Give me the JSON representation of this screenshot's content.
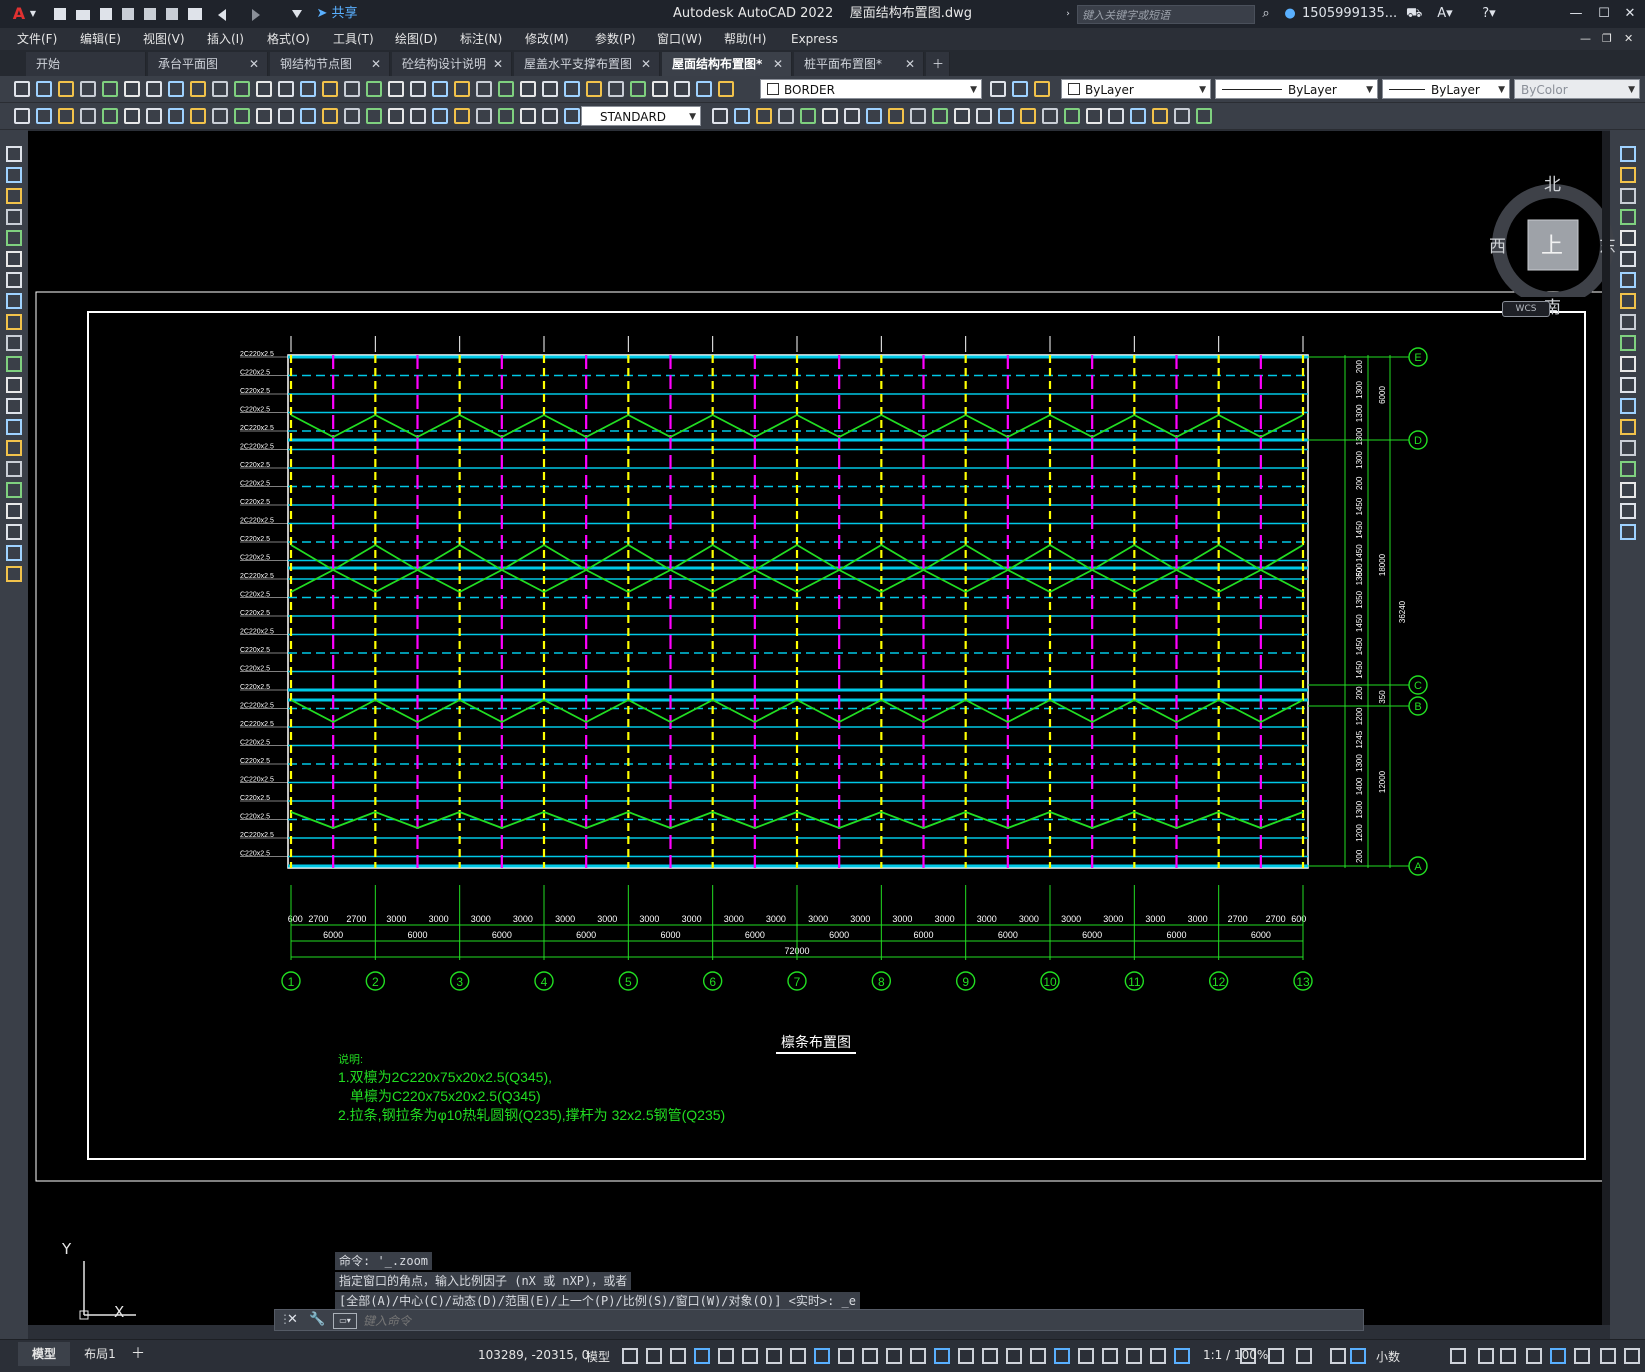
{
  "app": {
    "title": "Autodesk AutoCAD 2022",
    "filename": "屋面结构布置图.dwg",
    "share_label": "共享",
    "search_placeholder": "键入关键字或短语",
    "user": "1505999135...",
    "window_controls": [
      "minimize-icon",
      "maximize-icon",
      "close-icon"
    ]
  },
  "menu": [
    "文件(F)",
    "编辑(E)",
    "视图(V)",
    "插入(I)",
    "格式(O)",
    "工具(T)",
    "绘图(D)",
    "标注(N)",
    "修改(M)",
    "参数(P)",
    "窗口(W)",
    "帮助(H)",
    "Express"
  ],
  "tabs": [
    {
      "label": "开始",
      "active": false
    },
    {
      "label": "承台平面图",
      "active": false
    },
    {
      "label": "钢结构节点图",
      "active": false
    },
    {
      "label": "砼结构设计说明",
      "active": false
    },
    {
      "label": "屋盖水平支撑布置图",
      "active": false
    },
    {
      "label": "屋面结构布置图*",
      "active": true
    },
    {
      "label": "桩平面布置图*",
      "active": false
    }
  ],
  "toolbar": {
    "layer": "BORDER",
    "color": "ByLayer",
    "linetype": "ByLayer",
    "lineweight": "ByLayer",
    "plotstyle": "ByColor",
    "textstyle": "STANDARD"
  },
  "viewcube": {
    "north": "北",
    "south": "南",
    "east": "东",
    "west": "西",
    "face": "上",
    "wcs": "WCS"
  },
  "drawing": {
    "title": "檩条布置图",
    "notes": [
      "说明:",
      "1.双檩为2C220x75x20x2.5(Q345),",
      "单檩为C220x75x20x2.5(Q345)",
      "2.拉条,钢拉条为φ10热轧圆钢(Q235),撑杆为 32x2.5钢管(Q235)"
    ],
    "bottom_dims_top": [
      "600",
      "2700",
      "2700",
      "3000",
      "3000",
      "3000",
      "3000",
      "3000",
      "3000",
      "3000",
      "3000",
      "3000",
      "3000",
      "3000",
      "3000",
      "3000",
      "3000",
      "3000",
      "3000",
      "3000",
      "3000",
      "3000",
      "3000",
      "2700",
      "2700",
      "600"
    ],
    "bottom_dims_mid": [
      "6000",
      "6000",
      "6000",
      "6000",
      "6000",
      "6000",
      "6000",
      "6000",
      "6000",
      "6000",
      "6000",
      "6000"
    ],
    "bottom_total": "72000",
    "col_axes": [
      "1",
      "2",
      "3",
      "4",
      "5",
      "6",
      "7",
      "8",
      "9",
      "10",
      "11",
      "12",
      "13"
    ],
    "row_axes": [
      "E",
      "D",
      "C",
      "B",
      "A"
    ],
    "right_dims": [
      "200",
      "1300",
      "1300",
      "1300",
      "1300",
      "200",
      "1450",
      "1450",
      "1450",
      "1350",
      "1350",
      "1450",
      "1450",
      "1450",
      "200",
      "1200",
      "1245",
      "1300",
      "1400",
      "1300",
      "1200",
      "200"
    ],
    "right_totals": [
      "6000",
      "18000",
      "36240",
      "12000",
      "600",
      "350"
    ],
    "purlin_labels": [
      "2C220x2.5",
      "C220x2.5",
      "C220x2.5",
      "C220x2.5",
      "2C220x2.5",
      "2C220x2.5",
      "C220x2.5",
      "C220x2.5",
      "C220x2.5",
      "2C220x2.5",
      "C220x2.5",
      "C220x2.5",
      "2C220x2.5",
      "C220x2.5",
      "C220x2.5",
      "2C220x2.5",
      "C220x2.5",
      "C220x2.5",
      "C220x2.5",
      "2C220x2.5",
      "2C220x2.5",
      "C220x2.5",
      "C220x2.5",
      "2C220x2.5",
      "C220x2.5",
      "C220x2.5",
      "2C220x2.5",
      "C220x2.5",
      "C220x2.5",
      "2C220x2.5"
    ]
  },
  "ucs": {
    "x": "X",
    "y": "Y"
  },
  "command": {
    "history": [
      "命令: '_.zoom",
      "指定窗口的角点，输入比例因子 (nX 或 nXP)，或者",
      "[全部(A)/中心(C)/动态(D)/范围(E)/上一个(P)/比例(S)/窗口(W)/对象(O)] <实时>: _e"
    ],
    "placeholder": "键入命令"
  },
  "status": {
    "layout_tabs": [
      "模型",
      "布局1"
    ],
    "coords": "103289, -20315, 0",
    "mode": "模型",
    "scale": "1:1 / 100%",
    "units": "小数"
  },
  "colors": {
    "background": "#000000",
    "purlin": "#00c8e6",
    "brace": "#22dd22",
    "tie": "#ff00ff",
    "column": "#ffff00",
    "frame": "#ffffff"
  }
}
